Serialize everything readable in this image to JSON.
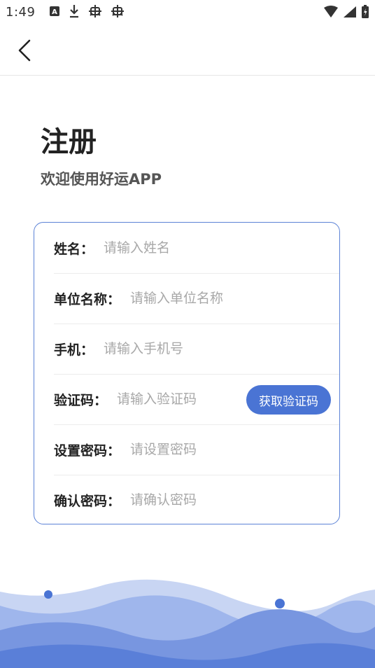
{
  "status_bar": {
    "time": "1:49",
    "left_icons": [
      "notification-a-icon",
      "download-icon",
      "bug-icon",
      "bug-icon"
    ],
    "right_icons": [
      "wifi-icon",
      "signal-icon",
      "battery-charging-icon"
    ]
  },
  "toolbar": {
    "back_icon": "chevron-left-icon"
  },
  "header": {
    "title": "注册",
    "subtitle": "欢迎使用好运APP"
  },
  "form": {
    "fields": [
      {
        "label": "姓名：",
        "placeholder": "请输入姓名",
        "value": ""
      },
      {
        "label": "单位名称：",
        "placeholder": "请输入单位名称",
        "value": ""
      },
      {
        "label": "手机：",
        "placeholder": "请输入手机号",
        "value": ""
      },
      {
        "label": "验证码：",
        "placeholder": "请输入验证码",
        "value": ""
      },
      {
        "label": "设置密码：",
        "placeholder": "请设置密码",
        "value": ""
      },
      {
        "label": "确认密码：",
        "placeholder": "请确认密码",
        "value": ""
      }
    ],
    "get_code_button": "获取验证码"
  },
  "colors": {
    "accent": "#4a74d4",
    "card_border": "#5b82d6",
    "wave_light": "#b9c9ef",
    "wave_mid": "#8aa6e6",
    "wave_dark": "#5a7fd8"
  }
}
